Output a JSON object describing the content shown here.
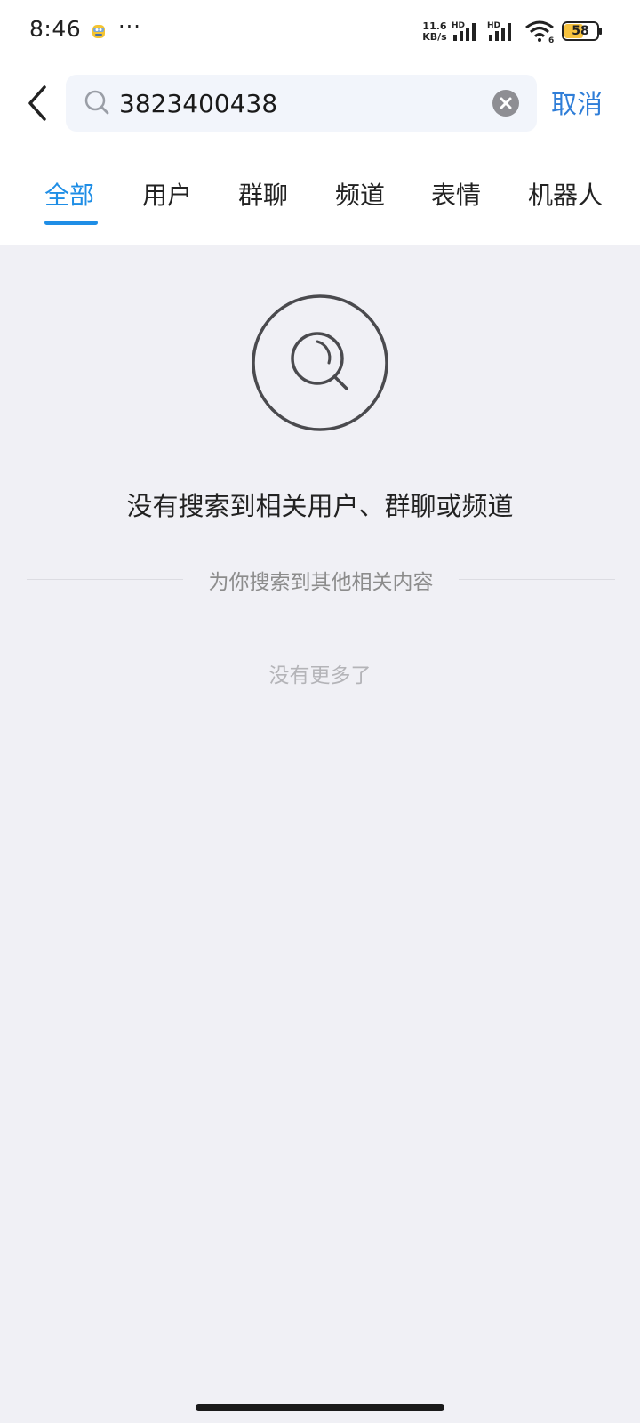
{
  "status_bar": {
    "time": "8:46",
    "more": "···",
    "net_speed_value": "11.6",
    "net_speed_unit": "KB/s",
    "signal1_label": "HD",
    "signal2_label": "HD",
    "wifi_label": "6",
    "battery": "58"
  },
  "search": {
    "query": "3823400438",
    "cancel_label": "取消"
  },
  "tabs": [
    {
      "label": "全部",
      "active": true
    },
    {
      "label": "用户",
      "active": false
    },
    {
      "label": "群聊",
      "active": false
    },
    {
      "label": "频道",
      "active": false
    },
    {
      "label": "表情",
      "active": false
    },
    {
      "label": "机器人",
      "active": false
    }
  ],
  "empty_state": {
    "title": "没有搜索到相关用户、群聊或频道",
    "related_label": "为你搜索到其他相关内容",
    "no_more_label": "没有更多了"
  },
  "colors": {
    "accent": "#1f8ee6",
    "cancel": "#2f7ed8",
    "page_bg": "#f0f0f5"
  }
}
